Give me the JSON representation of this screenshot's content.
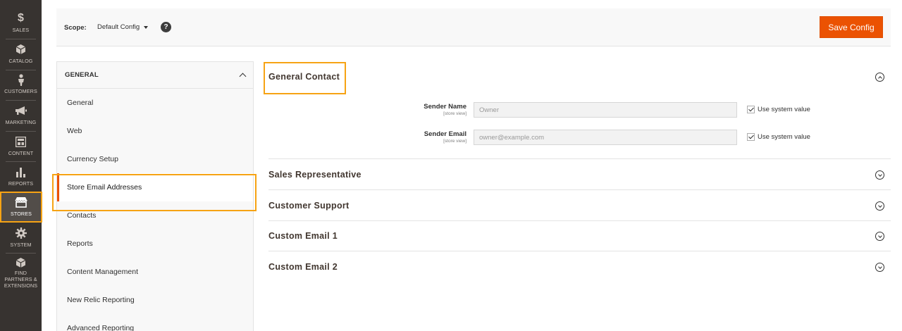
{
  "admin_nav": {
    "items": [
      {
        "icon": "dollar-icon",
        "glyph": "$",
        "label": "SALES"
      },
      {
        "icon": "catalog-box-icon",
        "glyph": "",
        "label": "CATALOG"
      },
      {
        "icon": "customers-person-icon",
        "glyph": "",
        "label": "CUSTOMERS"
      },
      {
        "icon": "megaphone-icon",
        "glyph": "",
        "label": "MARKETING"
      },
      {
        "icon": "content-layout-icon",
        "glyph": "",
        "label": "CONTENT"
      },
      {
        "icon": "bar-chart-icon",
        "glyph": "",
        "label": "REPORTS"
      },
      {
        "icon": "storefront-icon",
        "glyph": "",
        "label": "STORES"
      },
      {
        "icon": "gear-icon",
        "glyph": "",
        "label": "SYSTEM"
      },
      {
        "icon": "extensions-box-icon",
        "glyph": "",
        "label": "FIND PARTNERS & EXTENSIONS"
      }
    ],
    "active": "STORES",
    "highlight_color": "#f6a314"
  },
  "header": {
    "scope_label": "Scope:",
    "scope_value": "Default Config",
    "help_glyph": "?",
    "save_label": "Save Config",
    "save_color": "#eb5202"
  },
  "config_nav": {
    "group_title": "GENERAL",
    "items": [
      "General",
      "Web",
      "Currency Setup",
      "Store Email Addresses",
      "Contacts",
      "Reports",
      "Content Management",
      "New Relic Reporting",
      "Advanced Reporting"
    ],
    "active": "Store Email Addresses"
  },
  "sections": [
    {
      "title": "General Contact",
      "expanded": true,
      "fields": [
        {
          "label": "Sender Name",
          "scope": "[store view]",
          "value": "Owner",
          "use_system": "Use system value"
        },
        {
          "label": "Sender Email",
          "scope": "[store view]",
          "value": "owner@example.com",
          "use_system": "Use system value"
        }
      ]
    },
    {
      "title": "Sales Representative",
      "expanded": false
    },
    {
      "title": "Customer Support",
      "expanded": false
    },
    {
      "title": "Custom Email 1",
      "expanded": false
    },
    {
      "title": "Custom Email 2",
      "expanded": false
    }
  ]
}
